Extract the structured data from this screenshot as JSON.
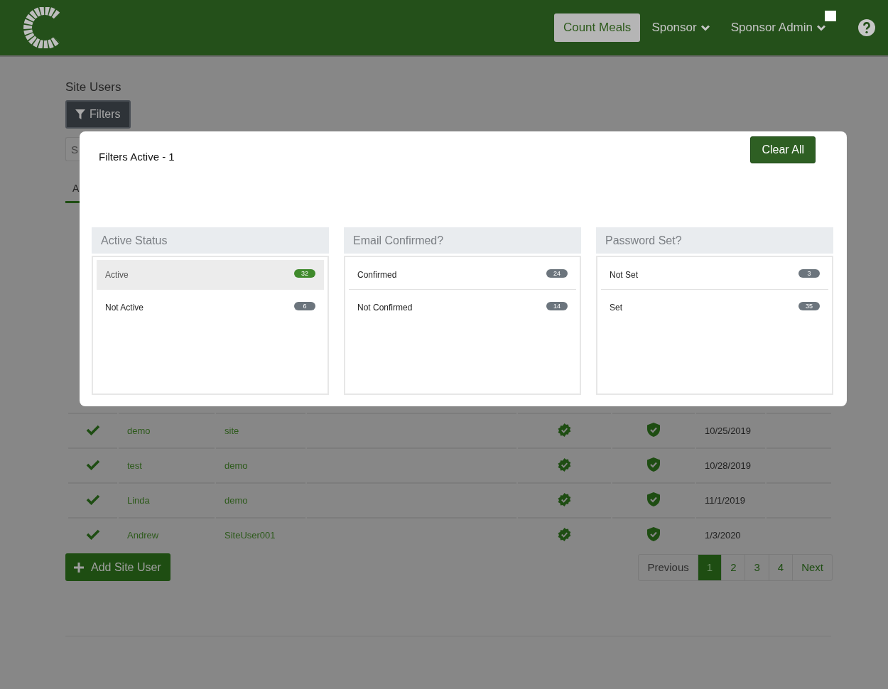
{
  "header": {
    "nav": [
      {
        "label": "Count Meals",
        "kind": "button"
      },
      {
        "label": "Sponsor",
        "kind": "dropdown"
      },
      {
        "label": "Sponsor Admin",
        "kind": "dropdown"
      }
    ],
    "marker": true
  },
  "page": {
    "title": "Site Users",
    "filters_button": "Filters",
    "search": {
      "placeholder": "S"
    },
    "tabs": [
      {
        "label": "A",
        "selected": true
      }
    ]
  },
  "table": {
    "rows": [
      {
        "active": true,
        "first_name": "demo",
        "last_name": "site",
        "email_confirmed": true,
        "password_set": true,
        "date": "10/25/2019"
      },
      {
        "active": true,
        "first_name": "test",
        "last_name": "demo",
        "email_confirmed": true,
        "password_set": true,
        "date": "10/28/2019"
      },
      {
        "active": true,
        "first_name": "Linda",
        "last_name": "demo",
        "email_confirmed": true,
        "password_set": true,
        "date": "11/1/2019"
      },
      {
        "active": true,
        "first_name": "Andrew",
        "last_name": "SiteUser001",
        "email_confirmed": true,
        "password_set": true,
        "date": "1/3/2020"
      }
    ]
  },
  "add_button": "Add Site User",
  "pagination": [
    {
      "label": "Previous",
      "selected": false
    },
    {
      "label": "1",
      "selected": true
    },
    {
      "label": "2",
      "selected": false
    },
    {
      "label": "3",
      "selected": false
    },
    {
      "label": "4",
      "selected": false
    },
    {
      "label": "Next",
      "selected": false
    }
  ],
  "filter_modal": {
    "title": "Filters Active - 1",
    "clear_button": "Clear All",
    "groups": [
      {
        "title": "Active Status",
        "options": [
          {
            "label": "Active",
            "count": "32",
            "selected": true
          },
          {
            "label": "Not Active",
            "count": "6",
            "selected": false
          }
        ]
      },
      {
        "title": "Email Confirmed?",
        "options": [
          {
            "label": "Confirmed",
            "count": "24",
            "selected": false
          },
          {
            "label": "Not Confirmed",
            "count": "14",
            "selected": false
          }
        ]
      },
      {
        "title": "Password Set?",
        "options": [
          {
            "label": "Not Set",
            "count": "3",
            "selected": false
          },
          {
            "label": "Set",
            "count": "35",
            "selected": false
          }
        ]
      }
    ]
  }
}
